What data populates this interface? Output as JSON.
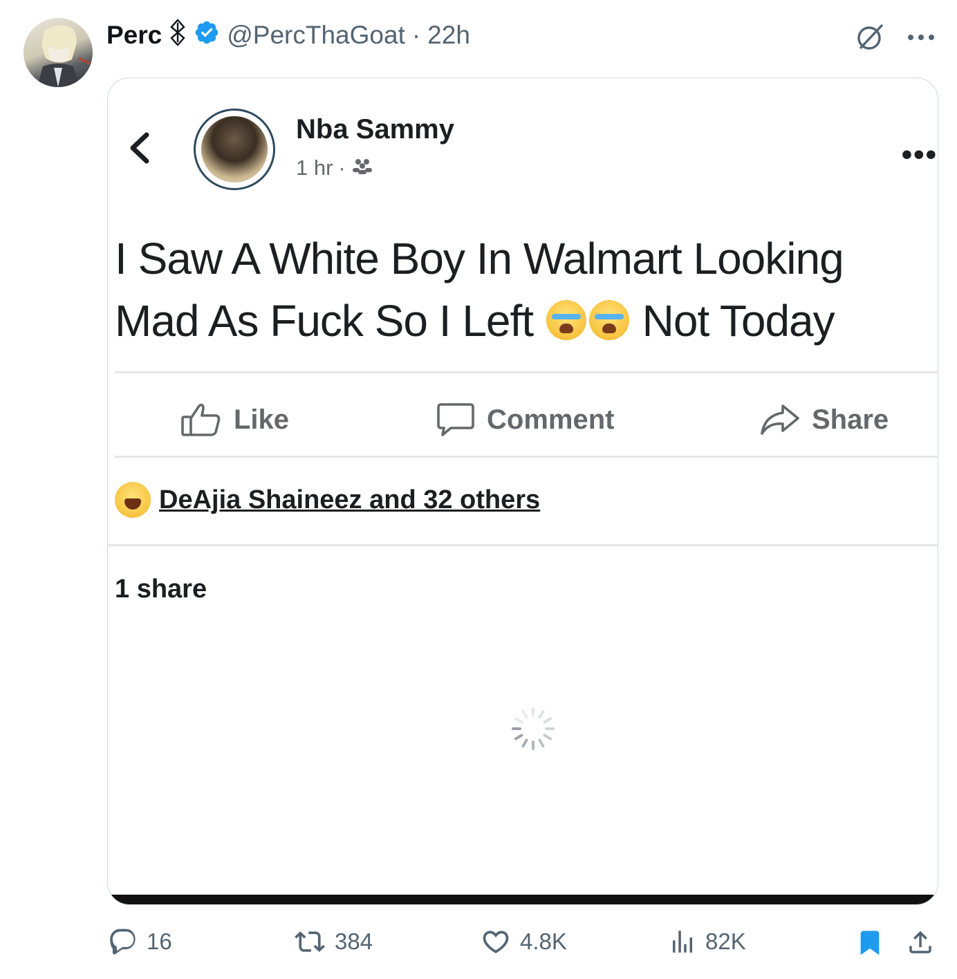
{
  "tweet": {
    "display_name": "Perc",
    "handle": "@PercThaGoat",
    "separator": "·",
    "time": "22h",
    "more_icon": "ellipsis-icon",
    "grok_icon": "grok-icon"
  },
  "embedded_post": {
    "author": "Nba Sammy",
    "time": "1 hr",
    "dot": "·",
    "privacy_icon": "friends-icon",
    "more": "•••",
    "text_line1": "I Saw A White Boy In Walmart Looking",
    "text_line2_a": "Mad As Fuck So I Left",
    "text_line2_b": "Not Today",
    "actions": {
      "like": "Like",
      "comment": "Comment",
      "share": "Share"
    },
    "reactions": "DeAjia Shaineez and 32 others",
    "shares": "1 share"
  },
  "stats": {
    "replies": "16",
    "reposts": "384",
    "likes": "4.8K",
    "views": "82K"
  },
  "colors": {
    "verified": "#1d9bf0",
    "bookmark": "#1d9bf0",
    "muted": "#536471"
  }
}
